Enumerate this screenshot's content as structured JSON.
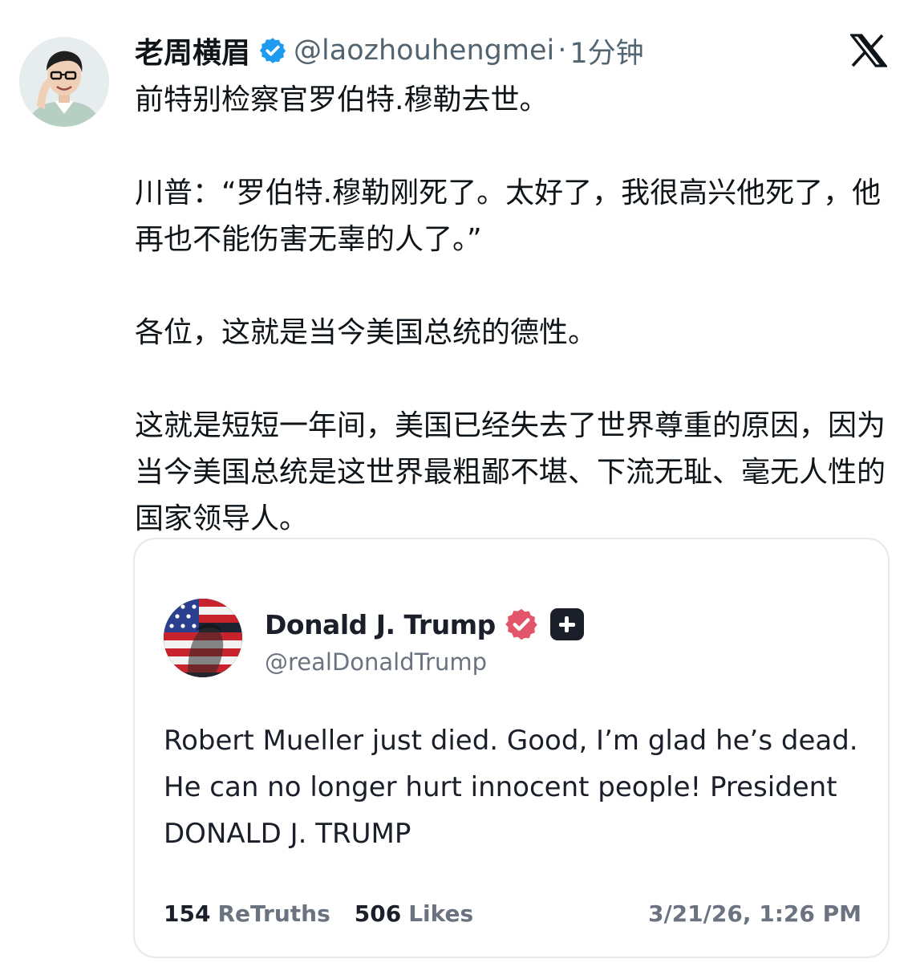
{
  "post": {
    "author_name": "老周横眉",
    "handle": "@laozhouhengmei",
    "separator": "·",
    "time": "1分钟",
    "verified_icon": "verified-badge-icon",
    "platform_icon": "x-logo-icon",
    "paragraphs": [
      "前特别检察官罗伯特.穆勒去世。",
      "川普：“罗伯特.穆勒刚死了。太好了，我很高兴他死了，他再也不能伤害无辜的人了。”",
      "各位，这就是当今美国总统的德性。",
      "这就是短短一年间，美国已经失去了世界尊重的原因，因为当今美国总统是这世界最粗鄙不堪、下流无耻、毫无人性的国家领导人。"
    ]
  },
  "quoted_post": {
    "author_name": "Donald J. Trump",
    "handle": "@realDonaldTrump",
    "verified_icon": "verified-badge-icon",
    "extra_icon": "plus-badge-icon",
    "text": "Robert Mueller just died. Good, I’m glad he’s dead. He can no longer hurt innocent people! President DONALD J. TRUMP",
    "retruths_count": "154",
    "retruths_label": "ReTruths",
    "likes_count": "506",
    "likes_label": "Likes",
    "timestamp": "3/21/26, 1:26 PM"
  },
  "colors": {
    "text_primary": "#0f1419",
    "text_secondary": "#536471",
    "verified_blue": "#1d9bf0",
    "truth_badge": "#e3556b",
    "card_border": "#e6e8ea"
  }
}
